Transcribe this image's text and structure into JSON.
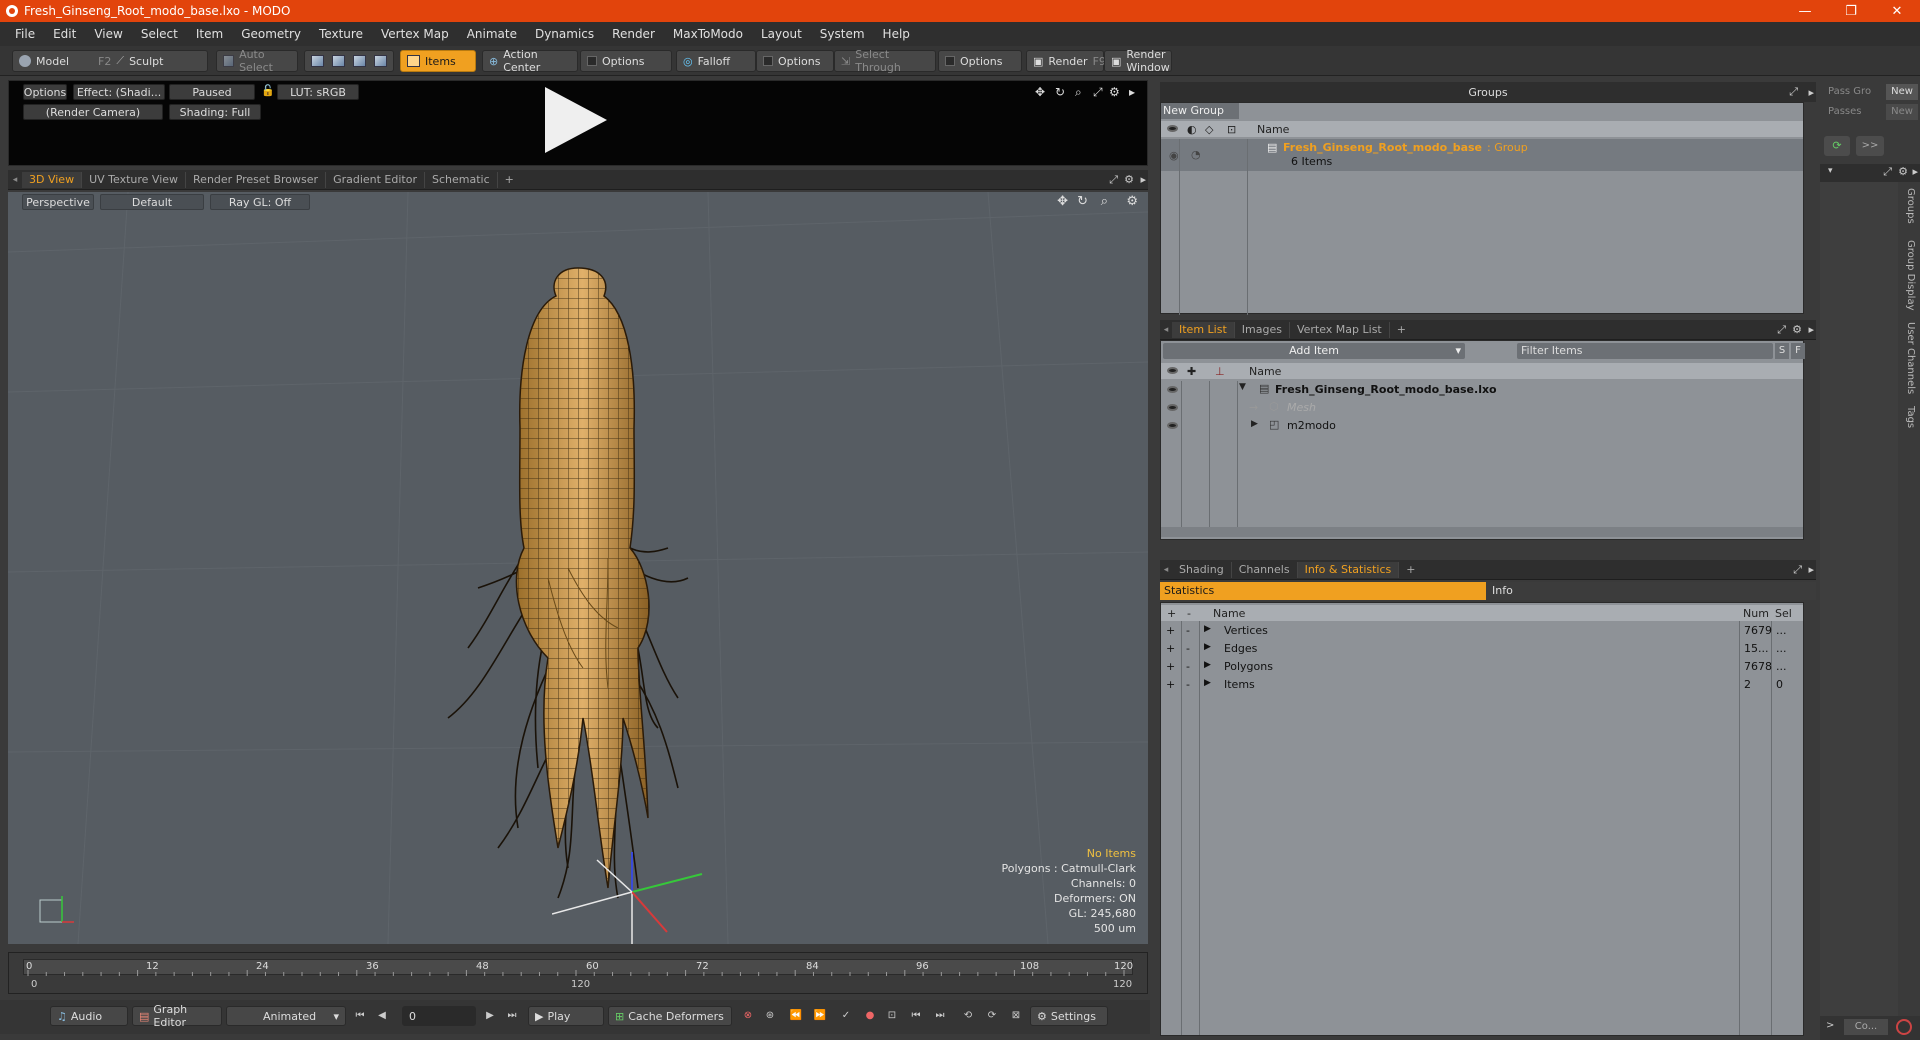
{
  "window": {
    "title": "Fresh_Ginseng_Root_modo_base.lxo - MODO",
    "minimize": "—",
    "maximize": "❐",
    "close": "✕"
  },
  "menu": [
    "File",
    "Edit",
    "View",
    "Select",
    "Item",
    "Geometry",
    "Texture",
    "Vertex Map",
    "Animate",
    "Dynamics",
    "Render",
    "MaxToModo",
    "Layout",
    "System",
    "Help"
  ],
  "toolbar": {
    "model": "Model",
    "model_key": "F2",
    "sculpt": "Sculpt",
    "auto_select": "Auto Select",
    "items": "Items",
    "action_center": "Action Center",
    "options1": "Options",
    "falloff": "Falloff",
    "options2": "Options",
    "select_through": "Select Through",
    "options3": "Options",
    "render": "Render",
    "render_key": "F9",
    "render_window": "Render Window"
  },
  "preview": {
    "options": "Options",
    "effect": "Effect: (Shadi...",
    "paused": "Paused",
    "lut": "LUT: sRGB",
    "camera": "(Render Camera)",
    "shading": "Shading: Full"
  },
  "view_tabs": [
    "3D View",
    "UV Texture View",
    "Render Preset Browser",
    "Gradient Editor",
    "Schematic",
    "+"
  ],
  "viewport": {
    "perspective": "Perspective",
    "default": "Default",
    "raygl": "Ray GL: Off",
    "no_items": "No Items",
    "polygons": "Polygons : Catmull-Clark",
    "channels": "Channels: 0",
    "deformers": "Deformers: ON",
    "gl": "GL: 245,680",
    "scale": "500 um"
  },
  "timeline": {
    "ticks": [
      "0",
      "12",
      "24",
      "36",
      "48",
      "60",
      "72",
      "84",
      "96",
      "108",
      "120"
    ],
    "range_start": "0",
    "range_mid": "120",
    "range_end": "120"
  },
  "bottom": {
    "audio": "Audio",
    "graph_editor": "Graph Editor",
    "animated": "Animated",
    "frame": "0",
    "play": "Play",
    "cache": "Cache Deformers",
    "settings": "Settings"
  },
  "groups": {
    "title": "Groups",
    "new_group": "New Group",
    "col_name": "Name",
    "item_name": "Fresh_Ginseng_Root_modo_base",
    "item_type": " : Group",
    "item_count": "6 Items"
  },
  "right_sidebar": {
    "pass_group": "Pass Gro",
    "new1": "New",
    "passes": "Passes",
    "new2": "New",
    "more": ">>",
    "vtabs": [
      "Groups",
      "Group Display",
      "User Channels",
      "Tags"
    ],
    "bottom_btn": "Co..."
  },
  "item_list": {
    "tabs": [
      "Item List",
      "Images",
      "Vertex Map List",
      "+"
    ],
    "add_item": "Add Item",
    "filter": "Filter Items",
    "s": "S",
    "f": "F",
    "col_name": "Name",
    "rows": [
      "Fresh_Ginseng_Root_modo_base.lxo",
      "Mesh",
      "m2modo"
    ]
  },
  "info": {
    "tabs": [
      "Shading",
      "Channels",
      "Info & Statistics",
      "+"
    ],
    "statistics": "Statistics",
    "info": "Info",
    "cols": {
      "plus": "+",
      "minus": "-",
      "name": "Name",
      "num": "Num",
      "sel": "Sel"
    },
    "rows": [
      {
        "name": "Vertices",
        "num": "7679",
        "sel": "..."
      },
      {
        "name": "Edges",
        "num": "15...",
        "sel": "..."
      },
      {
        "name": "Polygons",
        "num": "7678",
        "sel": "..."
      },
      {
        "name": "Items",
        "num": "2",
        "sel": "0"
      }
    ]
  }
}
